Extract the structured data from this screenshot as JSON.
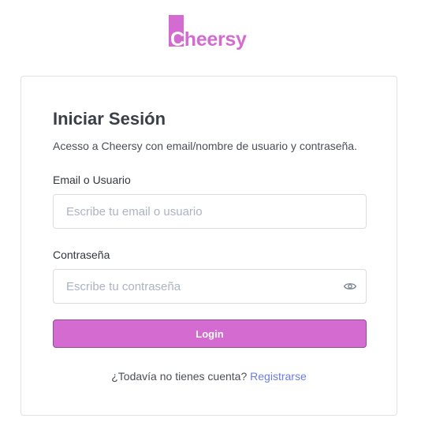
{
  "brand": {
    "name_first": "C",
    "name_rest": "heersy",
    "color": "#d36bd0"
  },
  "login": {
    "title": "Iniciar Sesión",
    "subtitle": "Acesso a Cheersy con email/nombre de usuario y contraseña.",
    "email_label": "Email o Usuario",
    "email_placeholder": "Escribe tu email o usuario",
    "email_value": "",
    "password_label": "Contraseña",
    "password_placeholder": "Escribe tu contraseña",
    "password_value": "",
    "password_toggle_icon": "eye-icon",
    "submit_label": "Login",
    "signup_prompt": "¿Todavía no tienes cuenta?",
    "signup_link": "Registrarse",
    "accent_color": "#d36bd0",
    "link_color": "#6b7de0"
  }
}
